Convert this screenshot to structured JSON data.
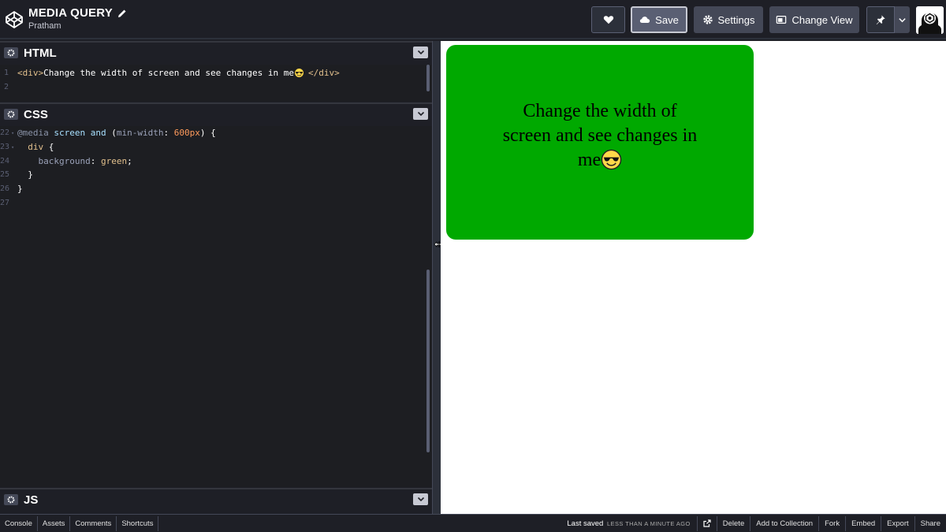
{
  "header": {
    "title": "MEDIA QUERY",
    "author": "Pratham",
    "save_label": "Save",
    "settings_label": "Settings",
    "change_view_label": "Change View"
  },
  "panes": {
    "html": {
      "name": "HTML",
      "lines": [
        "1",
        "2"
      ]
    },
    "css": {
      "name": "CSS",
      "lines": [
        "22",
        "23",
        "24",
        "25",
        "26",
        "27"
      ]
    },
    "js": {
      "name": "JS"
    }
  },
  "code": {
    "html_line1": {
      "open": "<div>",
      "text": "Change the width of screen and see changes in me",
      "close": "</div>"
    },
    "css": {
      "at": "@media",
      "screen": "screen",
      "and": "and",
      "paren_open": " (",
      "prop": "min-width",
      "colon": ": ",
      "num": "600px",
      "paren_close": ") {",
      "selector": "div",
      "brace_open": " {",
      "bg_prop": "background",
      "bg_val": "green",
      "semicolon": ";",
      "brace_close_inner": "}",
      "brace_close_outer": "}"
    }
  },
  "preview": {
    "text": "Change the width of screen and see changes in me",
    "bg_color": "#00a900"
  },
  "footer": {
    "left": [
      "Console",
      "Assets",
      "Comments",
      "Shortcuts"
    ],
    "last_saved": "Last saved",
    "last_saved_when": "LESS THAN A MINUTE AGO",
    "right": [
      "Delete",
      "Add to Collection",
      "Fork",
      "Embed",
      "Export",
      "Share"
    ]
  },
  "icons": {
    "logo": "codepen-logo-icon",
    "heart": "heart-icon",
    "save": "cloud-icon",
    "settings": "gear-icon",
    "view": "change-view-icon",
    "pin": "pin-icon",
    "dropdown": "chevron-down-icon",
    "emoji": "smiling-face-with-sunglasses-icon"
  }
}
